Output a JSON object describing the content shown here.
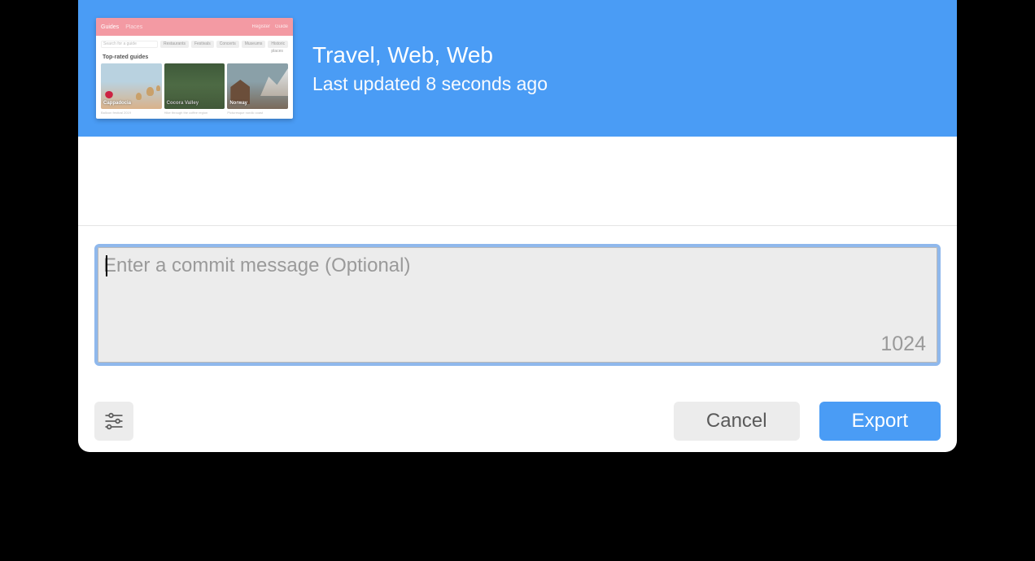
{
  "header": {
    "title": "Travel, Web, Web",
    "subtitle": "Last updated 8 seconds ago"
  },
  "thumbnail": {
    "nav_primary": "Guides",
    "nav_secondary": "Places",
    "nav_right_1": "Register",
    "nav_right_2": "Guide",
    "search_placeholder": "Search for a guide",
    "tags": [
      "Restaurants",
      "Festivals",
      "Concerts",
      "Museums",
      "Historic places"
    ],
    "section_title": "Top-rated guides",
    "cards": [
      {
        "label": "Cappadocia"
      },
      {
        "label": "Cocora Valley"
      },
      {
        "label": "Norway"
      }
    ],
    "captions": [
      "Balloon festival 2019",
      "Hike through the coffee region",
      "Picturesque nordic coast"
    ]
  },
  "commit": {
    "placeholder": "Enter a commit message (Optional)",
    "value": "",
    "char_limit": "1024"
  },
  "footer": {
    "cancel_label": "Cancel",
    "export_label": "Export"
  },
  "icons": {
    "settings": "sliders-icon"
  }
}
